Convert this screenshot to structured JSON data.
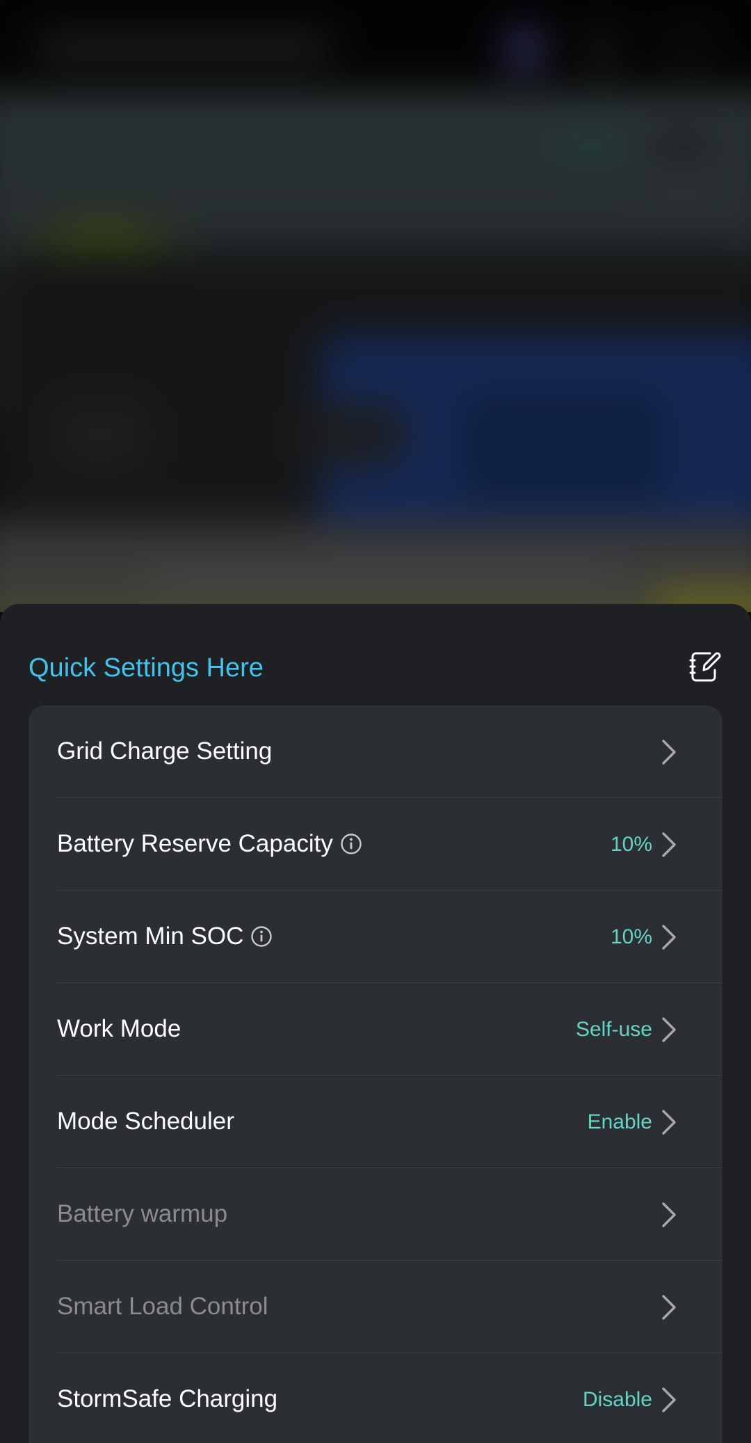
{
  "colors": {
    "accent_title": "#45c2ec",
    "value_teal": "#66d4c4",
    "sheet_bg": "#1e2024",
    "card_bg": "#2b2e33",
    "text_primary": "#ffffff",
    "text_disabled": "#8a8c90"
  },
  "sheet": {
    "title": "Quick Settings Here",
    "edit_icon": "edit-note-icon"
  },
  "settings": [
    {
      "label": "Grid Charge Setting",
      "value": "",
      "info": false,
      "enabled": true
    },
    {
      "label": "Battery Reserve Capacity",
      "value": "10%",
      "info": true,
      "enabled": true
    },
    {
      "label": "System Min SOC",
      "value": "10%",
      "info": true,
      "enabled": true
    },
    {
      "label": "Work Mode",
      "value": "Self-use",
      "info": false,
      "enabled": true
    },
    {
      "label": "Mode Scheduler",
      "value": "Enable",
      "info": false,
      "enabled": true
    },
    {
      "label": "Battery warmup",
      "value": "",
      "info": false,
      "enabled": false
    },
    {
      "label": "Smart Load Control",
      "value": "",
      "info": false,
      "enabled": false
    },
    {
      "label": "StormSafe Charging",
      "value": "Disable",
      "info": false,
      "enabled": true
    }
  ]
}
